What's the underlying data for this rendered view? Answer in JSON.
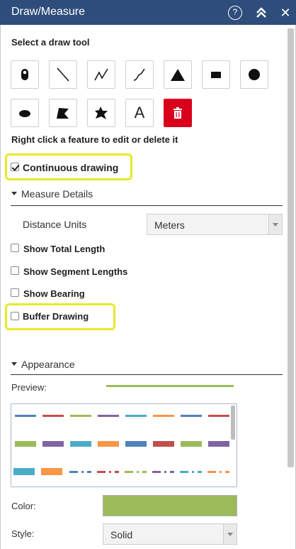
{
  "header": {
    "title": "Draw/Measure",
    "help_label": "?",
    "collapse_icon": "double-chevron-up-icon",
    "close_label": "✕"
  },
  "draw": {
    "heading": "Select a draw tool",
    "tools": [
      {
        "name": "point",
        "icon": "point-marker-icon"
      },
      {
        "name": "line",
        "icon": "line-icon"
      },
      {
        "name": "polyline",
        "icon": "polyline-icon"
      },
      {
        "name": "freehand-polyline",
        "icon": "freehand-line-icon"
      },
      {
        "name": "triangle",
        "icon": "triangle-icon"
      },
      {
        "name": "rectangle",
        "icon": "rectangle-icon"
      },
      {
        "name": "circle",
        "icon": "circle-icon"
      },
      {
        "name": "ellipse",
        "icon": "ellipse-icon"
      },
      {
        "name": "polygon",
        "icon": "polygon-icon"
      },
      {
        "name": "freehand-polygon",
        "icon": "freehand-polygon-icon"
      },
      {
        "name": "text",
        "icon": "text-icon",
        "label": "A"
      },
      {
        "name": "delete",
        "icon": "trash-icon"
      }
    ],
    "edit_hint": "Right click a feature to edit or delete it",
    "continuous_label": "Continuous drawing",
    "continuous_checked": true
  },
  "measure": {
    "section_label": "Measure Details",
    "distance_units_label": "Distance Units",
    "distance_units_value": "Meters",
    "options": [
      {
        "label": "Show Total Length",
        "checked": false
      },
      {
        "label": "Show Segment Lengths",
        "checked": false
      },
      {
        "label": "Show Bearing",
        "checked": false
      },
      {
        "label": "Buffer Drawing",
        "checked": false
      }
    ]
  },
  "appearance": {
    "section_label": "Appearance",
    "preview_label": "Preview:",
    "preview_color": "#9bbb59",
    "palette_colors": [
      "#4f81bd",
      "#c0504d",
      "#9bbb59",
      "#8064a2",
      "#4bacc6",
      "#f79646"
    ],
    "color_label": "Color:",
    "color_value": "#9bbb59",
    "style_label": "Style:",
    "style_value": "Solid"
  },
  "colors": {
    "header_bg": "#2e4d7b",
    "delete_bg": "#d9001b",
    "highlight": "#e6ea2a"
  }
}
